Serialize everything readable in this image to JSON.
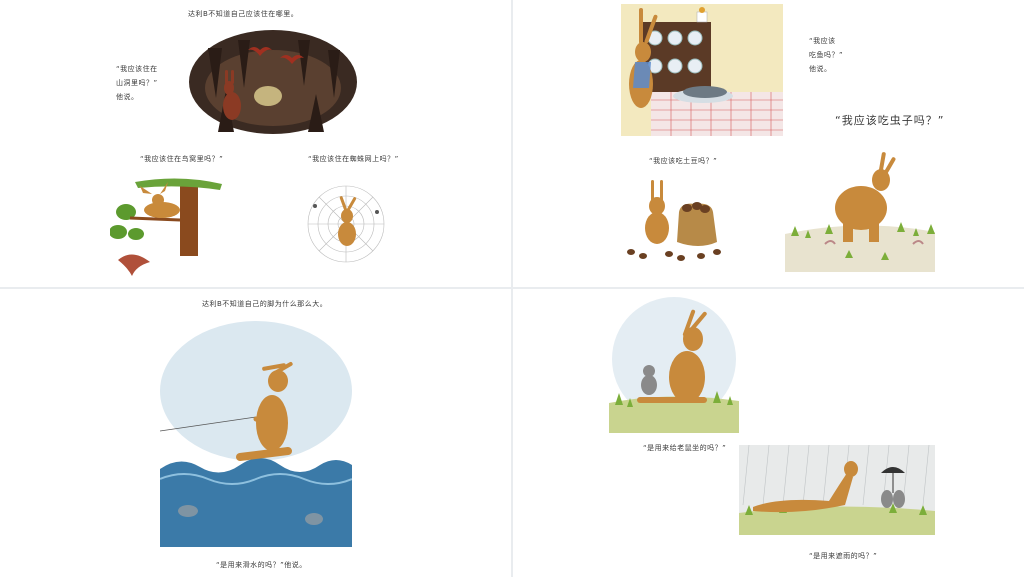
{
  "panels": [
    {
      "texts": {
        "top": "达利B不知道自己应该住在哪里。",
        "cave_q": "“我应该住在\n山洞里吗？”\n他说。",
        "nest_q": "“我应该住在鸟窝里吗？”",
        "web_q": "“我应该住在蜘蛛网上吗？”"
      }
    },
    {
      "texts": {
        "fish_q": "“我应该\n吃鱼吗？”\n他说。",
        "bug_q": "“我应该吃虫子吗？”",
        "potato_q": "“我应该吃土豆吗？”"
      }
    },
    {
      "texts": {
        "top": "达利B不知道自己的脚为什么那么大。",
        "ski_q": "“是用来滑水的吗？”他说。"
      }
    },
    {
      "texts": {
        "mouse_q": "“是用来给老鼠坐的吗？”",
        "rain_q": "“是用来遮雨的吗？”"
      }
    }
  ],
  "colors": {
    "rabbit": "#c88a3c",
    "sea": "#3b7aa8",
    "grass": "#7cae3a",
    "cave": "#3a2a22",
    "sky": "#dbe8f0"
  }
}
